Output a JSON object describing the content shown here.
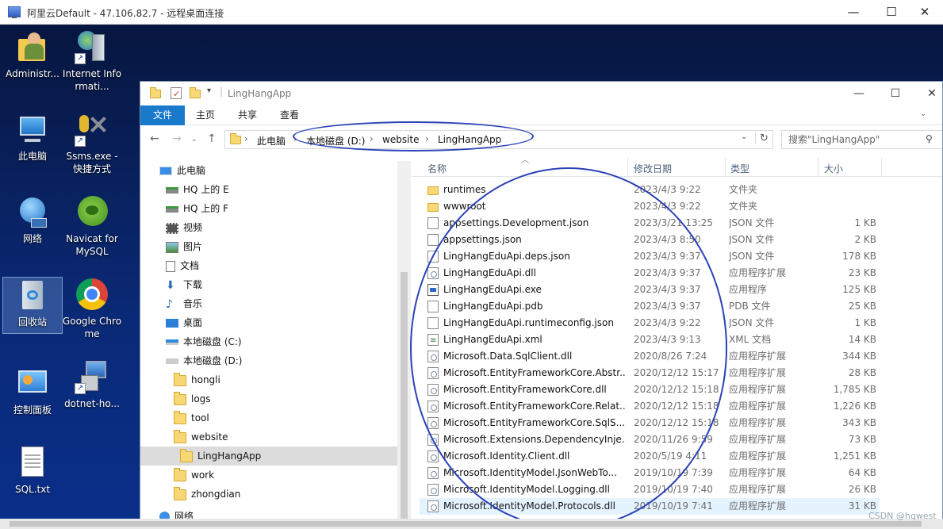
{
  "rdp": {
    "title": "阿里云Default - 47.106.82.7 - 远程桌面连接",
    "min": "—",
    "max": "☐",
    "close": "✕"
  },
  "desktop": {
    "icons": [
      {
        "label": "Administr...",
        "icon": "user-folder-icon"
      },
      {
        "label": "Internet Informati...",
        "icon": "iis-icon"
      },
      {
        "label": "此电脑",
        "icon": "computer-icon"
      },
      {
        "label": "Ssms.exe - 快捷方式",
        "icon": "ssms-icon"
      },
      {
        "label": "网络",
        "icon": "network-icon"
      },
      {
        "label": "Navicat for MySQL",
        "icon": "navicat-icon"
      },
      {
        "label": "回收站",
        "icon": "recycle-bin-icon"
      },
      {
        "label": "Google Chrome",
        "icon": "chrome-icon"
      },
      {
        "label": "控制面板",
        "icon": "control-panel-icon"
      },
      {
        "label": "dotnet-ho...",
        "icon": "installer-icon"
      },
      {
        "label": "SQL.txt",
        "icon": "text-file-icon"
      }
    ]
  },
  "explorer": {
    "title": "LingHangApp",
    "ribbon_tabs": [
      "文件",
      "主页",
      "共享",
      "查看"
    ],
    "breadcrumb": [
      "此电脑",
      "本地磁盘 (D:)",
      "website",
      "LingHangApp"
    ],
    "search_placeholder": "搜索\"LingHangApp\"",
    "columns": {
      "name": "名称",
      "date": "修改日期",
      "type": "类型",
      "size": "大小"
    },
    "nav_items": [
      {
        "label": "此电脑",
        "icon": "computer-icon"
      },
      {
        "label": "HQ 上的 E",
        "icon": "network-drive-icon"
      },
      {
        "label": "HQ 上的 F",
        "icon": "network-drive-icon"
      },
      {
        "label": "视频",
        "icon": "video-icon"
      },
      {
        "label": "图片",
        "icon": "pictures-icon"
      },
      {
        "label": "文档",
        "icon": "documents-icon"
      },
      {
        "label": "下载",
        "icon": "download-icon"
      },
      {
        "label": "音乐",
        "icon": "music-icon"
      },
      {
        "label": "桌面",
        "icon": "desktop-icon"
      },
      {
        "label": "本地磁盘 (C:)",
        "icon": "drive-icon"
      },
      {
        "label": "本地磁盘 (D:)",
        "icon": "drive-icon"
      },
      {
        "label": "hongli",
        "icon": "folder-icon"
      },
      {
        "label": "logs",
        "icon": "folder-icon"
      },
      {
        "label": "tool",
        "icon": "folder-icon"
      },
      {
        "label": "website",
        "icon": "folder-icon"
      },
      {
        "label": "LingHangApp",
        "icon": "folder-icon"
      },
      {
        "label": "work",
        "icon": "folder-icon"
      },
      {
        "label": "zhongdian",
        "icon": "folder-icon"
      },
      {
        "label": "网络",
        "icon": "network-icon"
      }
    ],
    "files": [
      {
        "name": "runtimes",
        "date": "2023/4/3 9:22",
        "type": "文件夹",
        "size": "",
        "kind": "folder"
      },
      {
        "name": "wwwroot",
        "date": "2023/4/3 9:22",
        "type": "文件夹",
        "size": "",
        "kind": "folder"
      },
      {
        "name": "appsettings.Development.json",
        "date": "2023/3/21 13:25",
        "type": "JSON 文件",
        "size": "1 KB",
        "kind": "doc"
      },
      {
        "name": "appsettings.json",
        "date": "2023/4/3 8:50",
        "type": "JSON 文件",
        "size": "2 KB",
        "kind": "doc"
      },
      {
        "name": "LingHangEduApi.deps.json",
        "date": "2023/4/3 9:37",
        "type": "JSON 文件",
        "size": "178 KB",
        "kind": "doc"
      },
      {
        "name": "LingHangEduApi.dll",
        "date": "2023/4/3 9:37",
        "type": "应用程序扩展",
        "size": "23 KB",
        "kind": "dll"
      },
      {
        "name": "LingHangEduApi.exe",
        "date": "2023/4/3 9:37",
        "type": "应用程序",
        "size": "125 KB",
        "kind": "exe"
      },
      {
        "name": "LingHangEduApi.pdb",
        "date": "2023/4/3 9:37",
        "type": "PDB 文件",
        "size": "25 KB",
        "kind": "doc"
      },
      {
        "name": "LingHangEduApi.runtimeconfig.json",
        "date": "2023/4/3 9:22",
        "type": "JSON 文件",
        "size": "1 KB",
        "kind": "doc"
      },
      {
        "name": "LingHangEduApi.xml",
        "date": "2023/4/3 9:13",
        "type": "XML 文档",
        "size": "14 KB",
        "kind": "xml"
      },
      {
        "name": "Microsoft.Data.SqlClient.dll",
        "date": "2020/8/26 7:24",
        "type": "应用程序扩展",
        "size": "344 KB",
        "kind": "dll"
      },
      {
        "name": "Microsoft.EntityFrameworkCore.Abstr...",
        "date": "2020/12/12 15:17",
        "type": "应用程序扩展",
        "size": "28 KB",
        "kind": "dll"
      },
      {
        "name": "Microsoft.EntityFrameworkCore.dll",
        "date": "2020/12/12 15:18",
        "type": "应用程序扩展",
        "size": "1,785 KB",
        "kind": "dll"
      },
      {
        "name": "Microsoft.EntityFrameworkCore.Relat...",
        "date": "2020/12/12 15:18",
        "type": "应用程序扩展",
        "size": "1,226 KB",
        "kind": "dll"
      },
      {
        "name": "Microsoft.EntityFrameworkCore.SqlS...",
        "date": "2020/12/12 15:18",
        "type": "应用程序扩展",
        "size": "343 KB",
        "kind": "dll"
      },
      {
        "name": "Microsoft.Extensions.DependencyInje...",
        "date": "2020/11/26 9:59",
        "type": "应用程序扩展",
        "size": "73 KB",
        "kind": "dll"
      },
      {
        "name": "Microsoft.Identity.Client.dll",
        "date": "2020/5/19 4:11",
        "type": "应用程序扩展",
        "size": "1,251 KB",
        "kind": "dll"
      },
      {
        "name": "Microsoft.IdentityModel.JsonWebTo...",
        "date": "2019/10/19 7:39",
        "type": "应用程序扩展",
        "size": "64 KB",
        "kind": "dll"
      },
      {
        "name": "Microsoft.IdentityModel.Logging.dll",
        "date": "2019/10/19 7:40",
        "type": "应用程序扩展",
        "size": "26 KB",
        "kind": "dll"
      },
      {
        "name": "Microsoft.IdentityModel.Protocols.dll",
        "date": "2019/10/19 7:41",
        "type": "应用程序扩展",
        "size": "31 KB",
        "kind": "dll"
      }
    ]
  },
  "watermark": "CSDN @hqwest"
}
